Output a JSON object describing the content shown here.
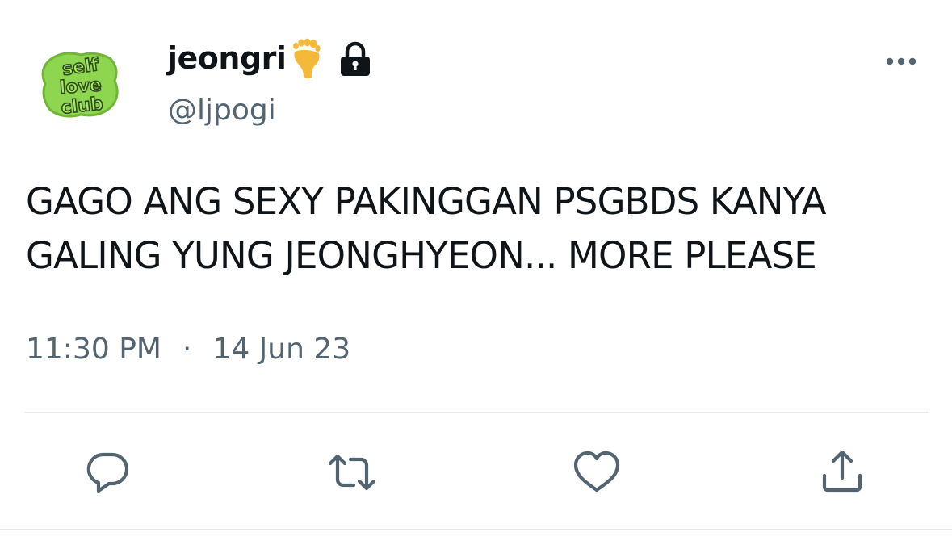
{
  "tweet": {
    "display_name": "jeongri",
    "handle": "@ljpogi",
    "text": "GAGO ANG SEXY PAKINGGAN PSGBDS KANYA\nGALING YUNG JEONGHYEON... MORE PLEASE",
    "time": "11:30 PM",
    "separator": "·",
    "date": "14 Jun 23",
    "avatar_text": [
      "self",
      "love",
      "club"
    ]
  },
  "icons": {
    "avatar": "self-love-club-logo",
    "name_emoji": "foot-icon",
    "protected": "lock-icon",
    "more": "more-icon",
    "reply": "reply-icon",
    "retweet": "retweet-icon",
    "like": "like-icon",
    "share": "share-icon"
  },
  "colors": {
    "text": "#0f1419",
    "secondary": "#536471",
    "divider": "#e7e9ea",
    "avatar_green": "#8ed64f",
    "avatar_dark": "#2f4a1e"
  }
}
